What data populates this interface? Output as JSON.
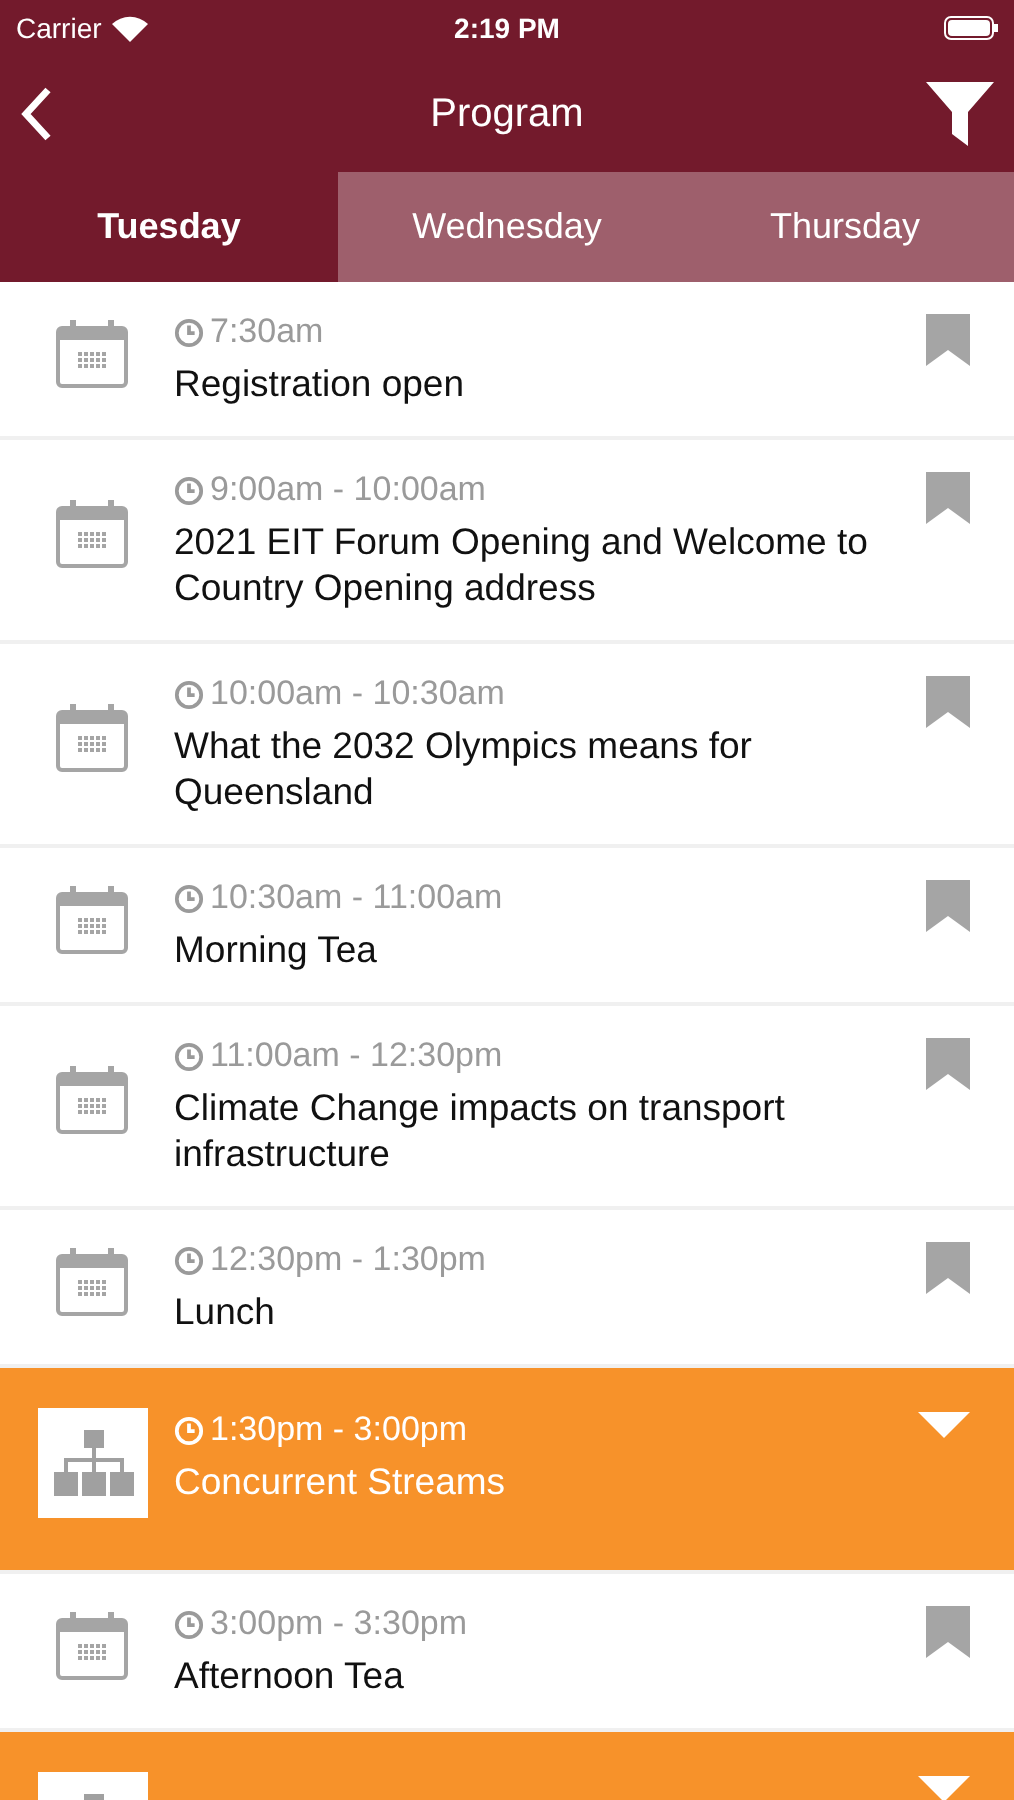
{
  "status_bar": {
    "carrier": "Carrier",
    "time": "2:19 PM"
  },
  "nav": {
    "title": "Program"
  },
  "tabs": [
    {
      "label": "Tuesday",
      "selected": true
    },
    {
      "label": "Wednesday",
      "selected": false
    },
    {
      "label": "Thursday",
      "selected": false
    }
  ],
  "sessions": [
    {
      "kind": "session",
      "time": "7:30am",
      "title": "Registration open"
    },
    {
      "kind": "session",
      "time": "9:00am - 10:00am",
      "title": "2021 EIT Forum Opening and Welcome to Country Opening address"
    },
    {
      "kind": "session",
      "time": "10:00am - 10:30am",
      "title": "What the 2032 Olympics means for Queensland"
    },
    {
      "kind": "session",
      "time": "10:30am - 11:00am",
      "title": "Morning Tea"
    },
    {
      "kind": "session",
      "time": "11:00am - 12:30pm",
      "title": "Climate Change impacts on transport infrastructure"
    },
    {
      "kind": "session",
      "time": "12:30pm - 1:30pm",
      "title": "Lunch"
    },
    {
      "kind": "stream",
      "time": "1:30pm - 3:00pm",
      "title": "Concurrent Streams"
    },
    {
      "kind": "session",
      "time": "3:00pm - 3:30pm",
      "title": "Afternoon Tea"
    },
    {
      "kind": "stream"
    }
  ]
}
